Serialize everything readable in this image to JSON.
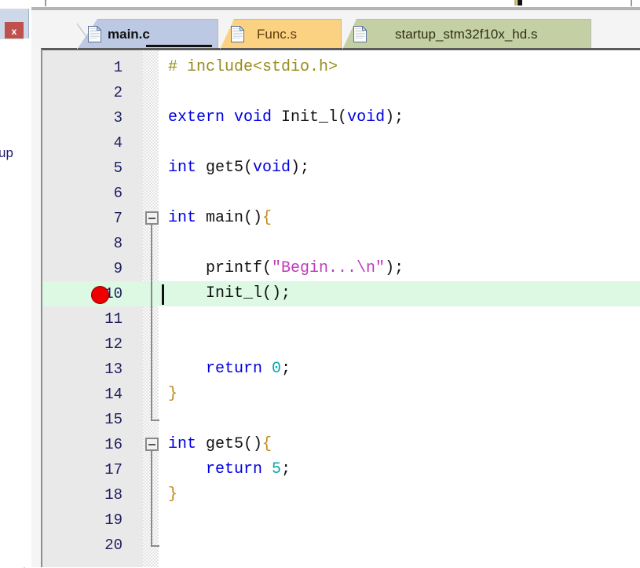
{
  "window": {
    "close_button_label": "x",
    "left_panel_partial_text": "up"
  },
  "tabs": [
    {
      "label": "main.c",
      "icon": "document-icon",
      "active": true,
      "color": "#bdc9e3"
    },
    {
      "label": "Func.s",
      "icon": "document-icon",
      "active": false,
      "color": "#fbd182"
    },
    {
      "label": "startup_stm32f10x_hd.s",
      "icon": "document-icon",
      "active": false,
      "color": "#c4d0a4"
    }
  ],
  "editor": {
    "language": "c",
    "current_line": 10,
    "breakpoint_lines": [
      10
    ],
    "highlight_color": "#ddf8e3",
    "breakpoint_color": "#ee0000",
    "fold_regions": [
      {
        "start": 7,
        "end": 15
      },
      {
        "start": 16,
        "end": 20
      }
    ],
    "lines": [
      {
        "n": "1",
        "tokens": [
          {
            "t": "# include<stdio.h>",
            "c": "pp"
          }
        ]
      },
      {
        "n": "2",
        "tokens": []
      },
      {
        "n": "3",
        "tokens": [
          {
            "t": "extern",
            "c": "kw"
          },
          {
            "t": " ",
            "c": "pun"
          },
          {
            "t": "void",
            "c": "kw"
          },
          {
            "t": " Init_l(",
            "c": "pun"
          },
          {
            "t": "void",
            "c": "kw"
          },
          {
            "t": ");",
            "c": "pun"
          }
        ]
      },
      {
        "n": "4",
        "tokens": []
      },
      {
        "n": "5",
        "tokens": [
          {
            "t": "int",
            "c": "kw"
          },
          {
            "t": " get5(",
            "c": "pun"
          },
          {
            "t": "void",
            "c": "kw"
          },
          {
            "t": ");",
            "c": "pun"
          }
        ]
      },
      {
        "n": "6",
        "tokens": []
      },
      {
        "n": "7",
        "tokens": [
          {
            "t": "int",
            "c": "kw"
          },
          {
            "t": " main()",
            "c": "pun"
          },
          {
            "t": "{",
            "c": "brc"
          }
        ]
      },
      {
        "n": "8",
        "tokens": []
      },
      {
        "n": "9",
        "tokens": [
          {
            "t": "    printf(",
            "c": "pun"
          },
          {
            "t": "\"Begin...\\n\"",
            "c": "str"
          },
          {
            "t": ");",
            "c": "pun"
          }
        ]
      },
      {
        "n": "10",
        "tokens": [
          {
            "t": "    Init_l();",
            "c": "pun"
          }
        ]
      },
      {
        "n": "11",
        "tokens": []
      },
      {
        "n": "12",
        "tokens": []
      },
      {
        "n": "13",
        "tokens": [
          {
            "t": "    ",
            "c": "pun"
          },
          {
            "t": "return",
            "c": "kw"
          },
          {
            "t": " ",
            "c": "pun"
          },
          {
            "t": "0",
            "c": "num"
          },
          {
            "t": ";",
            "c": "pun"
          }
        ]
      },
      {
        "n": "14",
        "tokens": [
          {
            "t": "}",
            "c": "brc"
          }
        ]
      },
      {
        "n": "15",
        "tokens": []
      },
      {
        "n": "16",
        "tokens": [
          {
            "t": "int",
            "c": "kw"
          },
          {
            "t": " get5()",
            "c": "pun"
          },
          {
            "t": "{",
            "c": "brc"
          }
        ]
      },
      {
        "n": "17",
        "tokens": [
          {
            "t": "    ",
            "c": "pun"
          },
          {
            "t": "return",
            "c": "kw"
          },
          {
            "t": " ",
            "c": "pun"
          },
          {
            "t": "5",
            "c": "num"
          },
          {
            "t": ";",
            "c": "pun"
          }
        ]
      },
      {
        "n": "18",
        "tokens": [
          {
            "t": "}",
            "c": "brc"
          }
        ]
      },
      {
        "n": "19",
        "tokens": []
      },
      {
        "n": "20",
        "tokens": []
      }
    ]
  }
}
